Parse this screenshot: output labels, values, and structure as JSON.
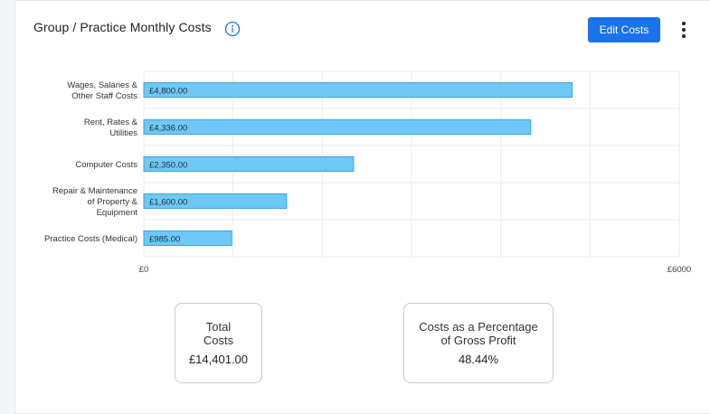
{
  "card": {
    "title": "Group / Practice Monthly Costs",
    "edit_label": "Edit Costs"
  },
  "colors": {
    "bar_fill": "#6ec8f5",
    "bar_stroke": "#3aa3e0",
    "grid": "#ececec",
    "accent": "#1a73e8"
  },
  "chart_data": {
    "type": "bar",
    "orientation": "horizontal",
    "categories": [
      [
        "Wages, Salaries &",
        "Other Staff Costs"
      ],
      [
        "Rent, Rates &",
        "Utilities"
      ],
      [
        "Computer Costs"
      ],
      [
        "Repair & Maintenance",
        "of Property &",
        "Equipment"
      ],
      [
        "Practice Costs (Medical)"
      ]
    ],
    "values": [
      4800,
      4336,
      2350,
      1600,
      985
    ],
    "data_labels": [
      "£4,800.00",
      "£4,336.00",
      "£2,350.00",
      "£1,600.00",
      "£985.00"
    ],
    "xlim": [
      0,
      6000
    ],
    "x_tick_labels": [
      "£0",
      "£6000"
    ],
    "grid": true
  },
  "stats": {
    "total_label": "Total Costs",
    "total_value": "£14,401.00",
    "pct_label": "Costs as a Percentage of Gross Profit",
    "pct_value": "48.44%"
  }
}
